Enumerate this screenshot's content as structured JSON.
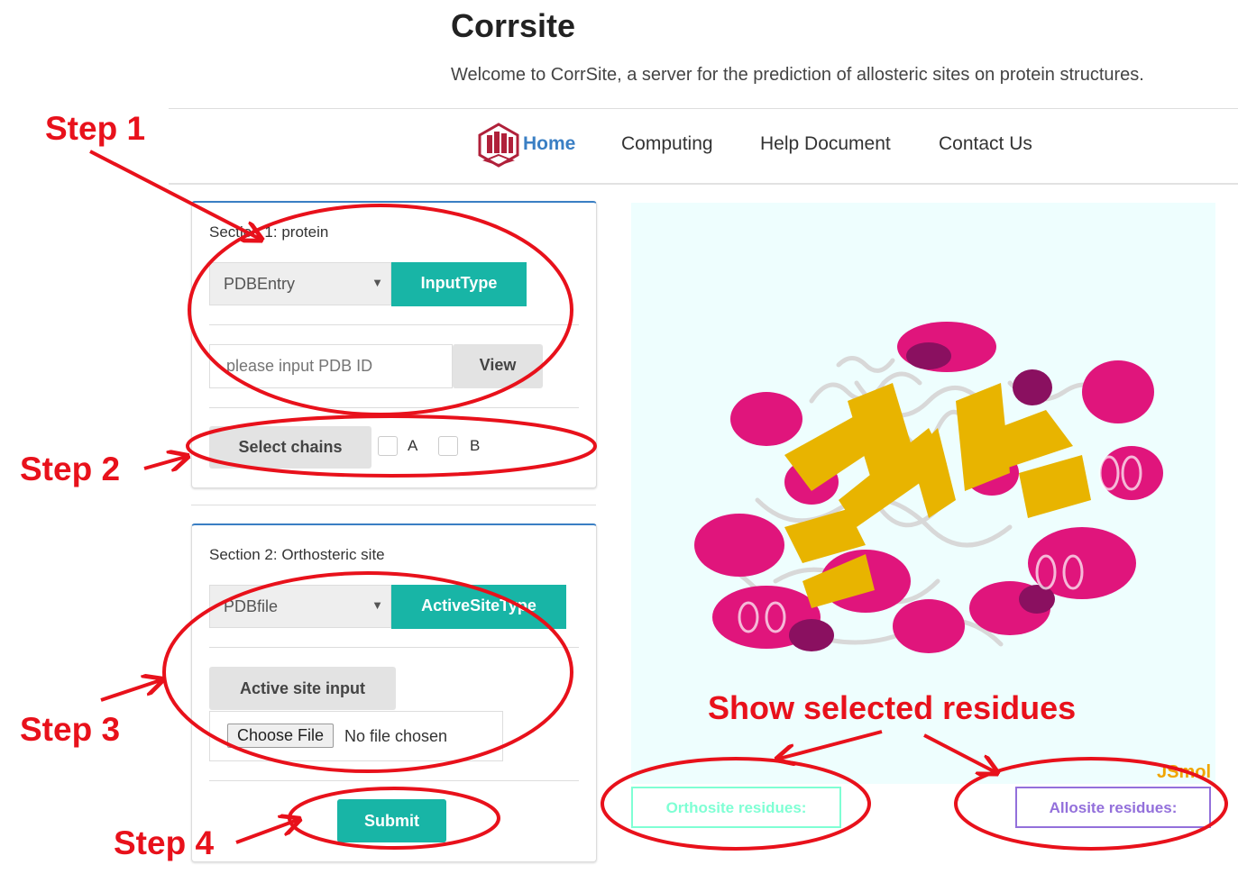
{
  "header": {
    "title": "Corrsite",
    "welcome": "Welcome to CorrSite, a server for the prediction of allosteric sites on protein structures."
  },
  "nav": {
    "home": "Home",
    "computing": "Computing",
    "help": "Help Document",
    "contact": "Contact Us"
  },
  "section1": {
    "title": "Section 1: protein",
    "select_value": "PDBEntry",
    "type_button": "InputType",
    "pdb_placeholder": "please input PDB ID",
    "view_button": "View",
    "chains_button": "Select chains",
    "chains": [
      "A",
      "B"
    ]
  },
  "section2": {
    "title": "Section 2: Orthosteric site",
    "select_value": "PDBfile",
    "type_button": "ActiveSiteType",
    "active_button": "Active site input",
    "choose_file": "Choose File",
    "no_file": "No file chosen",
    "submit": "Submit"
  },
  "viewer": {
    "brand": "JSmol",
    "orthosite_button": "Orthosite residues:",
    "allosite_button": "Allosite residues:"
  },
  "annotations": {
    "step1": "Step 1",
    "step2": "Step 2",
    "step3": "Step 3",
    "step4": "Step 4",
    "show_selected": "Show selected residues"
  },
  "colors": {
    "accent_teal": "#18b5a6",
    "link_blue": "#3a7fc4",
    "annotation_red": "#e8111b",
    "helix_magenta": "#e0157c",
    "strand_gold": "#e8b400",
    "allosite_purple": "#9370db",
    "orthosite_cyan": "#7fffd4"
  },
  "icons": {
    "logo": "corrsite-logo-icon",
    "select_caret": "caret-down-icon"
  }
}
